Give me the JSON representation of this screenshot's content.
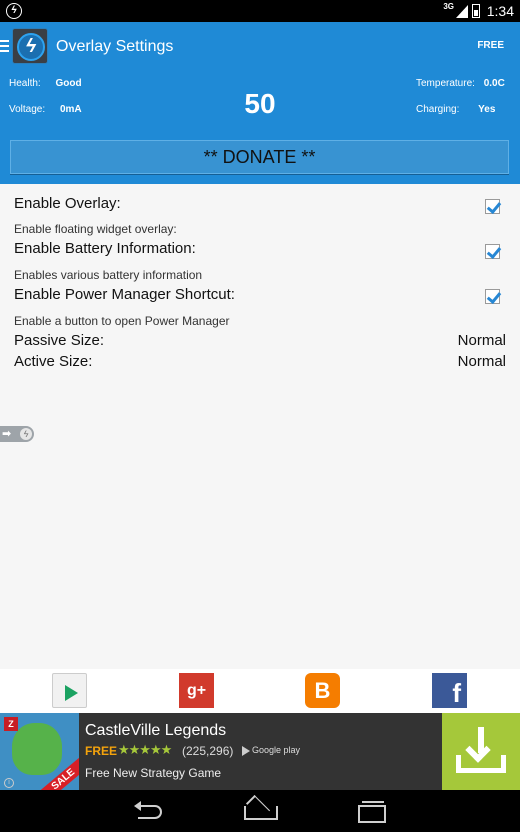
{
  "status_bar": {
    "network": "3G",
    "time": "1:34"
  },
  "header": {
    "title": "Overlay Settings",
    "free_label": "FREE",
    "health_label": "Health:",
    "health_value": "Good",
    "voltage_label": "Voltage:",
    "voltage_value": "0mA",
    "temperature_label": "Temperature:",
    "temperature_value": "0.0C",
    "charging_label": "Charging:",
    "charging_value": "Yes",
    "battery_level": "50",
    "donate_label": "** DONATE **"
  },
  "settings": {
    "enable_overlay": {
      "title": "Enable Overlay:",
      "subtitle": "Enable floating widget overlay:",
      "checked": true
    },
    "enable_battery_info": {
      "title": "Enable Battery Information:",
      "subtitle": "Enables various battery information",
      "checked": true
    },
    "enable_power_shortcut": {
      "title": "Enable Power Manager Shortcut:",
      "subtitle": "Enable a button to open Power Manager",
      "checked": true
    },
    "passive_size": {
      "title": "Passive Size:",
      "value": "Normal"
    },
    "active_size": {
      "title": "Active Size:",
      "value": "Normal"
    }
  },
  "share_bar": {
    "icons": [
      "play-store-icon",
      "google-plus-icon",
      "blogger-icon",
      "facebook-icon"
    ],
    "gplus_glyph": "g+",
    "blogger_glyph": "B",
    "facebook_glyph": "f"
  },
  "ad": {
    "title": "CastleVille Legends",
    "price": "FREE",
    "stars": "★★★★★",
    "rating": 4.5,
    "reviews": "(225,296)",
    "store": "Google play",
    "description": "Free New Strategy Game",
    "sale_badge": "SALE",
    "publisher_badge": "Z"
  },
  "colors": {
    "header_blue": "#1f8ad6",
    "ad_download_green": "#a5c83a",
    "checkbox_blue": "#2787d4"
  }
}
